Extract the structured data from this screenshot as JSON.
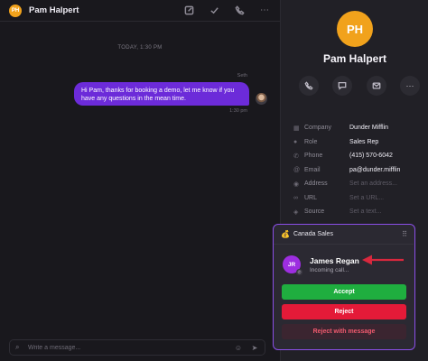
{
  "chat": {
    "header": {
      "avatar_initials": "PH",
      "name": "Pam Halpert"
    },
    "date_divider": "TODAY, 1:30 PM",
    "message": {
      "sender": "Seth",
      "text": "Hi Pam, thanks for booking a demo, let me know if you have any questions in the mean time.",
      "time": "1:30 pm"
    },
    "composer": {
      "placeholder": "Write a message..."
    }
  },
  "contact": {
    "avatar_initials": "PH",
    "name": "Pam Halpert",
    "fields": [
      {
        "icon": "building-icon",
        "label": "Company",
        "value": "Dunder Mifflin",
        "empty": false
      },
      {
        "icon": "person-icon",
        "label": "Role",
        "value": "Sales Rep",
        "empty": false
      },
      {
        "icon": "phone-icon",
        "label": "Phone",
        "value": "(415) 570-6042",
        "empty": false
      },
      {
        "icon": "at-icon",
        "label": "Email",
        "value": "pa@dunder.mifflin",
        "empty": false
      },
      {
        "icon": "location-icon",
        "label": "Address",
        "value": "Set an address...",
        "empty": true
      },
      {
        "icon": "link-icon",
        "label": "URL",
        "value": "Set a URL...",
        "empty": true
      },
      {
        "icon": "source-icon",
        "label": "Source",
        "value": "Set a text...",
        "empty": true
      }
    ]
  },
  "call": {
    "flag": "💰",
    "queue": "Canada Sales",
    "caller_initials": "JR",
    "caller_name": "James Regan",
    "caller_status": "Incoming call...",
    "accept_label": "Accept",
    "reject_label": "Reject",
    "reject_msg_label": "Reject with message"
  },
  "colors": {
    "accent_purple": "#6c2bd9",
    "widget_border": "#8b4fe8",
    "accept_green": "#1fae3f",
    "reject_red": "#e41a38",
    "avatar_orange": "#f1a21c"
  }
}
